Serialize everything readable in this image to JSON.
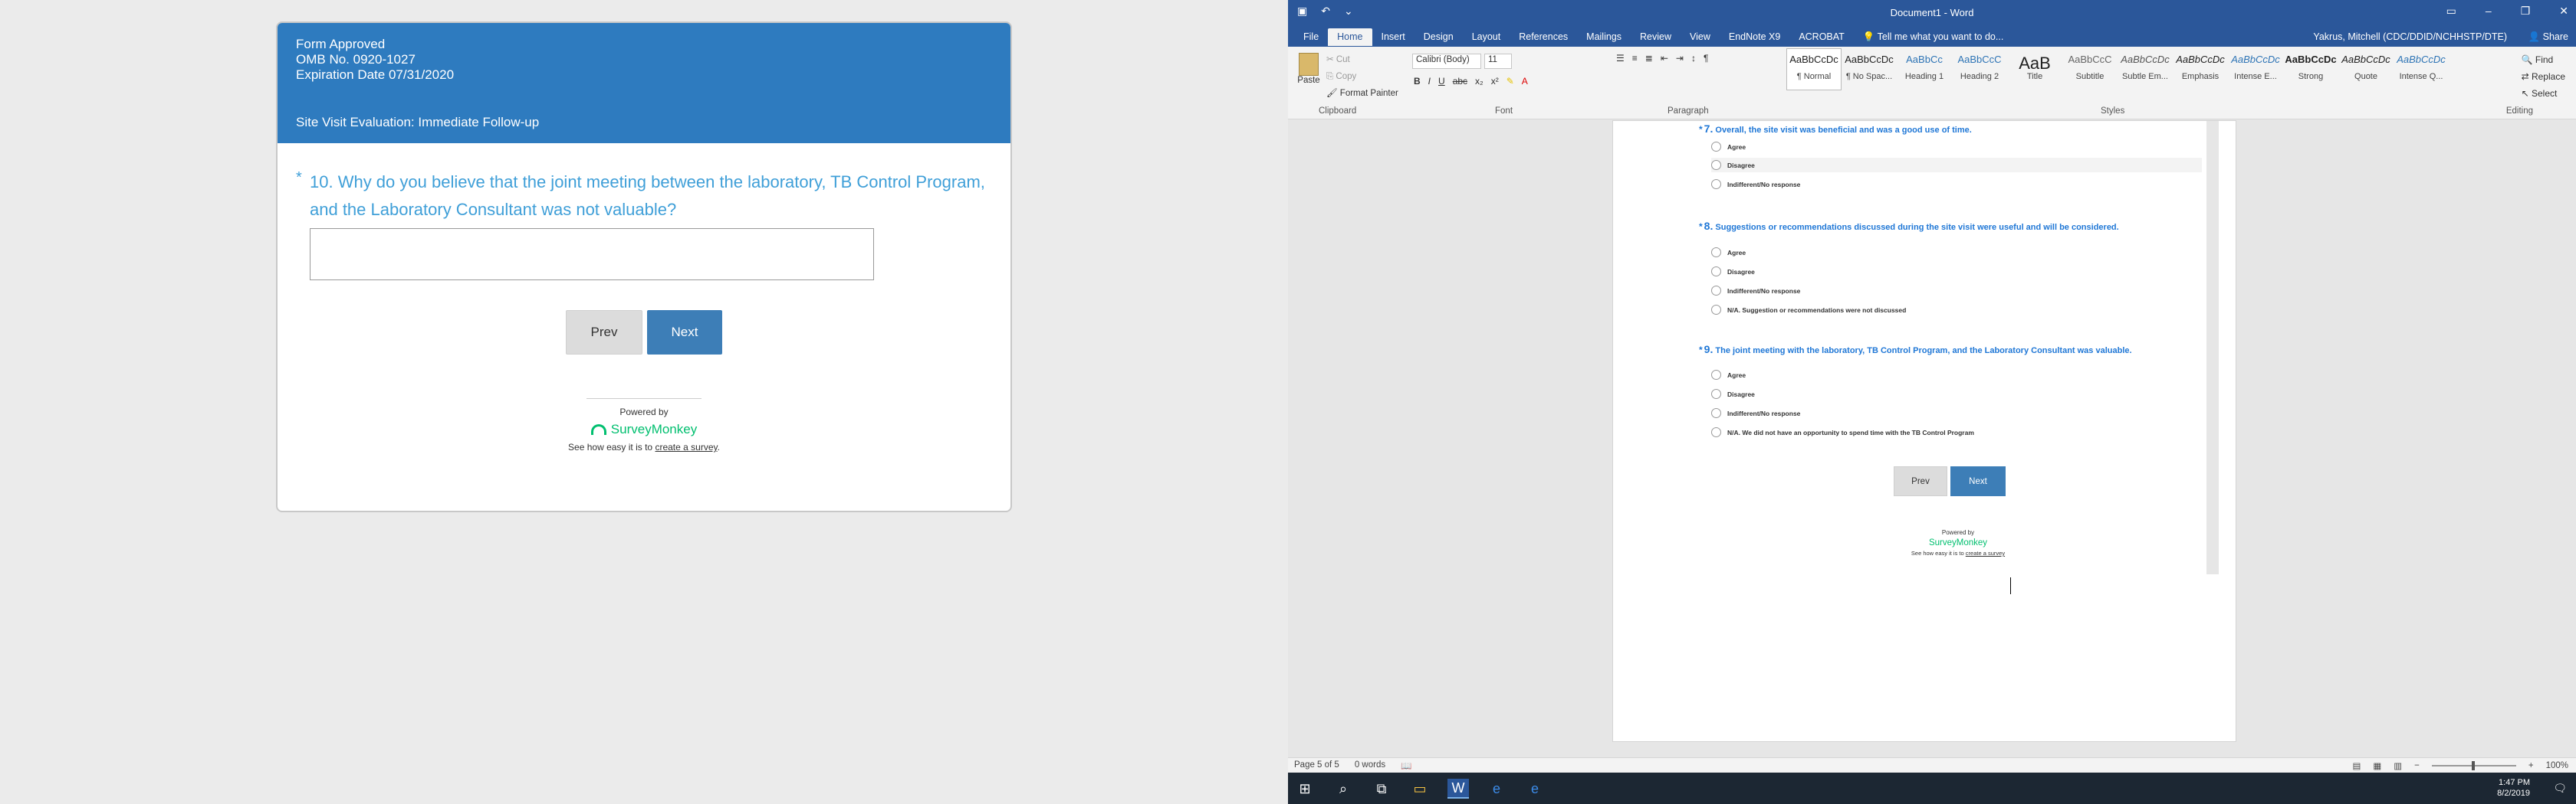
{
  "survey": {
    "header_lines": [
      "Form Approved",
      "OMB No. 0920-1027",
      "Expiration Date 07/31/2020"
    ],
    "title": "Site Visit Evaluation: Immediate Follow-up",
    "question": "10. Why do you believe that the joint meeting between the laboratory, TB Control Program, and the Laboratory Consultant was not valuable?",
    "star": "*",
    "answer_value": "",
    "prev_label": "Prev",
    "next_label": "Next",
    "powered_by": "Powered by",
    "brand": "SurveyMonkey",
    "easy_text": "See how easy it is to",
    "easy_link": "create a survey",
    "easy_end": "."
  },
  "word": {
    "window_title": "Document1 - Word",
    "tabs": [
      "File",
      "Home",
      "Insert",
      "Design",
      "Layout",
      "References",
      "Mailings",
      "Review",
      "View",
      "EndNote X9",
      "ACROBAT"
    ],
    "tell_me": "Tell me what you want to do...",
    "user": "Yakrus, Mitchell (CDC/DDID/NCHHSTP/DTE)",
    "share": "Share",
    "clipboard": {
      "paste": "Paste",
      "cut": "Cut",
      "copy": "Copy",
      "format_painter": "Format Painter",
      "label": "Clipboard"
    },
    "font": {
      "name": "Calibri (Body)",
      "size": "11",
      "label": "Font"
    },
    "paragraph_label": "Paragraph",
    "styles_label": "Styles",
    "editing_label": "Editing",
    "styles": [
      {
        "preview": "AaBbCcDc",
        "name": "¶ Normal"
      },
      {
        "preview": "AaBbCcDc",
        "name": "¶ No Spac..."
      },
      {
        "preview": "AaBbCc",
        "name": "Heading 1"
      },
      {
        "preview": "AaBbCcC",
        "name": "Heading 2"
      },
      {
        "preview": "AaB",
        "name": "Title"
      },
      {
        "preview": "AaBbCcC",
        "name": "Subtitle"
      },
      {
        "preview": "AaBbCcDc",
        "name": "Subtle Em..."
      },
      {
        "preview": "AaBbCcDc",
        "name": "Emphasis"
      },
      {
        "preview": "AaBbCcDc",
        "name": "Intense E..."
      },
      {
        "preview": "AaBbCcDc",
        "name": "Strong"
      },
      {
        "preview": "AaBbCcDc",
        "name": "Quote"
      },
      {
        "preview": "AaBbCcDc",
        "name": "Intense Q..."
      }
    ],
    "editing": {
      "find": "Find",
      "replace": "Replace",
      "select": "Select"
    },
    "doc": {
      "q7": {
        "num": "7.",
        "text": "Overall, the site visit was beneficial and was a good use of time.",
        "options": [
          "Agree",
          "Disagree",
          "Indifferent/No response"
        ]
      },
      "q8": {
        "num": "8.",
        "text": "Suggestions or recommendations discussed during the site visit were useful and will be considered.",
        "options": [
          "Agree",
          "Disagree",
          "Indifferent/No response",
          "N/A. Suggestion or recommendations were not discussed"
        ]
      },
      "q9": {
        "num": "9.",
        "text": "The joint meeting with the laboratory, TB Control Program, and the Laboratory Consultant was valuable.",
        "options": [
          "Agree",
          "Disagree",
          "Indifferent/No response",
          "N/A. We did not have an opportunity to spend time with the TB Control Program"
        ]
      },
      "prev": "Prev",
      "next": "Next",
      "powered_by": "Powered by",
      "brand": "SurveyMonkey",
      "easy_text": "See how easy it is to",
      "easy_link": "create a survey"
    },
    "status": {
      "page": "Page 5 of 5",
      "words": "0 words",
      "zoom": "100%"
    }
  },
  "taskbar": {
    "time": "1:47 PM",
    "date": "8/2/2019"
  }
}
